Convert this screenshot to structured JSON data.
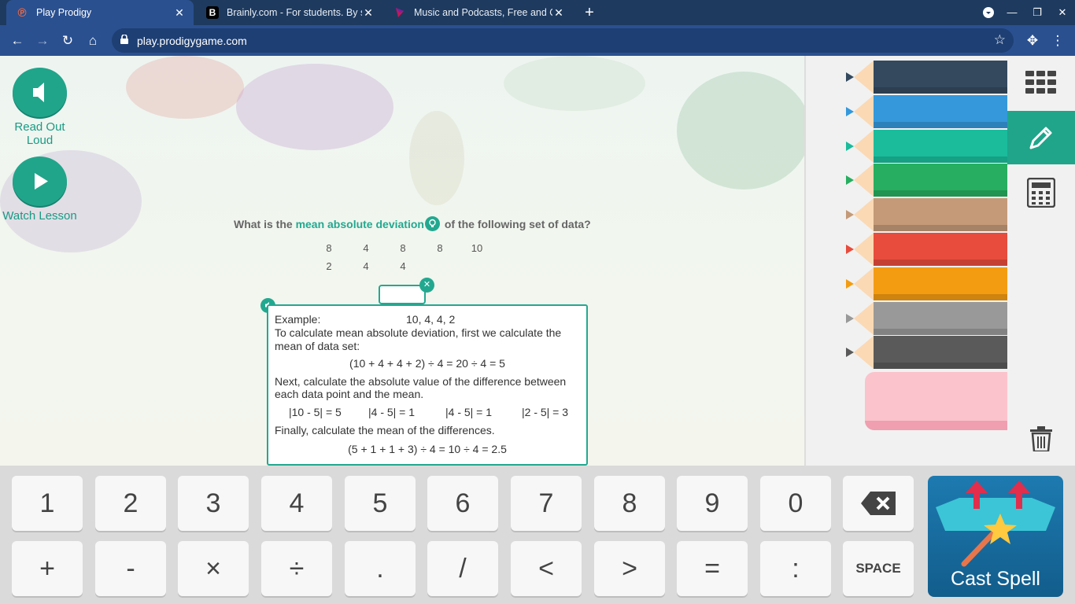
{
  "browser": {
    "tabs": [
      {
        "title": "Play Prodigy",
        "active": true
      },
      {
        "title": "Brainly.com - For students. By st",
        "active": false
      },
      {
        "title": "Music and Podcasts, Free and On",
        "active": false
      }
    ],
    "url": "play.prodigygame.com"
  },
  "sidebar": {
    "read_out_loud": "Read Out Loud",
    "watch_lesson": "Watch Lesson"
  },
  "question": {
    "prefix": "What is the ",
    "highlight": "mean absolute deviation",
    "suffix": " of the following set of data?",
    "data_row1": [
      "8",
      "4",
      "8",
      "8",
      "10"
    ],
    "data_row2": [
      "2",
      "4",
      "4"
    ],
    "answer_value": ""
  },
  "example": {
    "label": "Example:",
    "set": "10, 4, 4, 2",
    "line1": "To calculate mean absolute deviation, first we calculate the",
    "line2": "mean of data set:",
    "mean_eq": "(10 + 4 + 4 + 2) ÷ 4 = 20 ÷ 4 = 5",
    "line3": "Next, calculate the absolute value of the difference between",
    "line4": "each data point and the mean.",
    "diffs": [
      "|10 - 5| = 5",
      "|4 - 5| = 1",
      "|4 - 5| = 1",
      "|2 - 5| = 3"
    ],
    "line5": "Finally, calculate the mean of the differences.",
    "final_eq": "(5 + 1 + 1 + 3) ÷ 4 = 10 ÷ 4 = 2.5"
  },
  "tools": {
    "pencil_colors": [
      "#34495e",
      "#3498db",
      "#1abc9c",
      "#27ae60",
      "#c49a78",
      "#e74c3c",
      "#f39c12",
      "#999999",
      "#5a5a5a"
    ],
    "eraser_color": "#fbc3cc",
    "accent": "#20a58a"
  },
  "keypad": {
    "row1": [
      "1",
      "2",
      "3",
      "4",
      "5",
      "6",
      "7",
      "8",
      "9",
      "0"
    ],
    "row2": [
      "+",
      "-",
      "×",
      "÷",
      ".",
      "/",
      "<",
      ">",
      "=",
      ":"
    ],
    "space": "SPACE",
    "cast_spell": "Cast Spell"
  }
}
